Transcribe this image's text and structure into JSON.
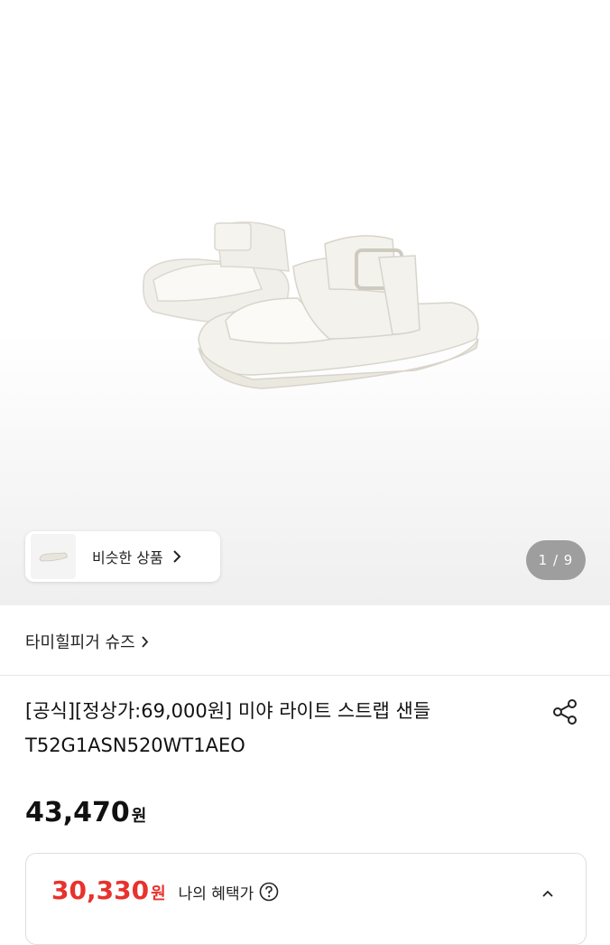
{
  "gallery": {
    "similar_label": "비슷한 상품",
    "counter": "1 / 9",
    "product_image_icon": "white-strap-sandals"
  },
  "brand": {
    "name": "타미힐피거 슈즈"
  },
  "product": {
    "title": "[공식][정상가:69,000원] 미야 라이트 스트랩 샌들 T52G1ASN520WT1AEO",
    "price": "43,470",
    "price_unit": "원"
  },
  "benefit": {
    "price": "30,330",
    "price_unit": "원",
    "label": "나의 혜택가"
  },
  "colors": {
    "accent_red": "#e8322d",
    "counter_bg": "#828282"
  }
}
